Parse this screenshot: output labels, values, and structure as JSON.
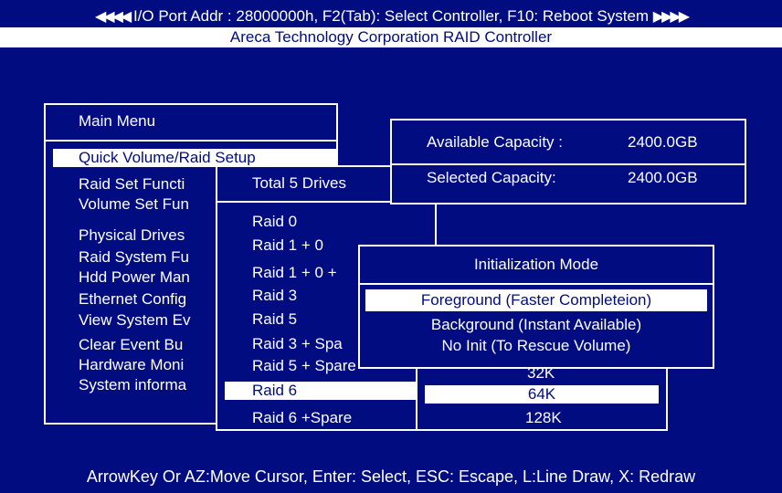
{
  "header": {
    "left_arrows": "◀◀◀◀",
    "text": "I/O Port Addr : 28000000h, F2(Tab): Select Controller, F10: Reboot System",
    "right_arrows": "▶▶▶▶",
    "subtitle": "Areca Technology Corporation RAID Controller"
  },
  "main_menu": {
    "title": "Main Menu",
    "items": [
      {
        "label": "Quick Volume/Raid Setup",
        "selected": true
      },
      {
        "label": "Raid Set Functi"
      },
      {
        "label": "Volume Set Fun"
      },
      {
        "label": "Physical Drives"
      },
      {
        "label": "Raid System Fu"
      },
      {
        "label": "Hdd Power Man"
      },
      {
        "label": "Ethernet Config"
      },
      {
        "label": "View System Ev"
      },
      {
        "label": "Clear Event Bu"
      },
      {
        "label": "Hardware Moni"
      },
      {
        "label": "System informa"
      }
    ]
  },
  "raid_menu": {
    "title": "Total 5 Drives",
    "items": [
      {
        "label": "Raid 0"
      },
      {
        "label": "Raid 1 + 0"
      },
      {
        "label": "Raid 1 + 0 +"
      },
      {
        "label": "Raid 3"
      },
      {
        "label": "Raid 5"
      },
      {
        "label": "Raid 3 + Spa"
      },
      {
        "label": "Raid 5 + Spare"
      },
      {
        "label": "Raid 6",
        "selected": true
      },
      {
        "label": "Raid 6 +Spare"
      }
    ]
  },
  "capacity": {
    "available_label": "Available Capacity :",
    "available_value": "2400.0GB",
    "selected_label": "Selected Capacity:",
    "selected_value": "2400.0GB"
  },
  "stripe_menu": {
    "items": [
      {
        "label": "32K"
      },
      {
        "label": "64K",
        "selected": true
      },
      {
        "label": "128K"
      }
    ]
  },
  "init_mode": {
    "title": "Initialization Mode",
    "items": [
      {
        "label": "Foreground (Faster Completeion)",
        "selected": true
      },
      {
        "label": "Background (Instant Available)"
      },
      {
        "label": "No Init (To Rescue Volume)"
      }
    ]
  },
  "footer": {
    "help": "ArrowKey Or AZ:Move Cursor, Enter: Select, ESC: Escape, L:Line Draw, X: Redraw"
  },
  "colors": {
    "background": "#000c80",
    "foreground": "#ffffff"
  }
}
